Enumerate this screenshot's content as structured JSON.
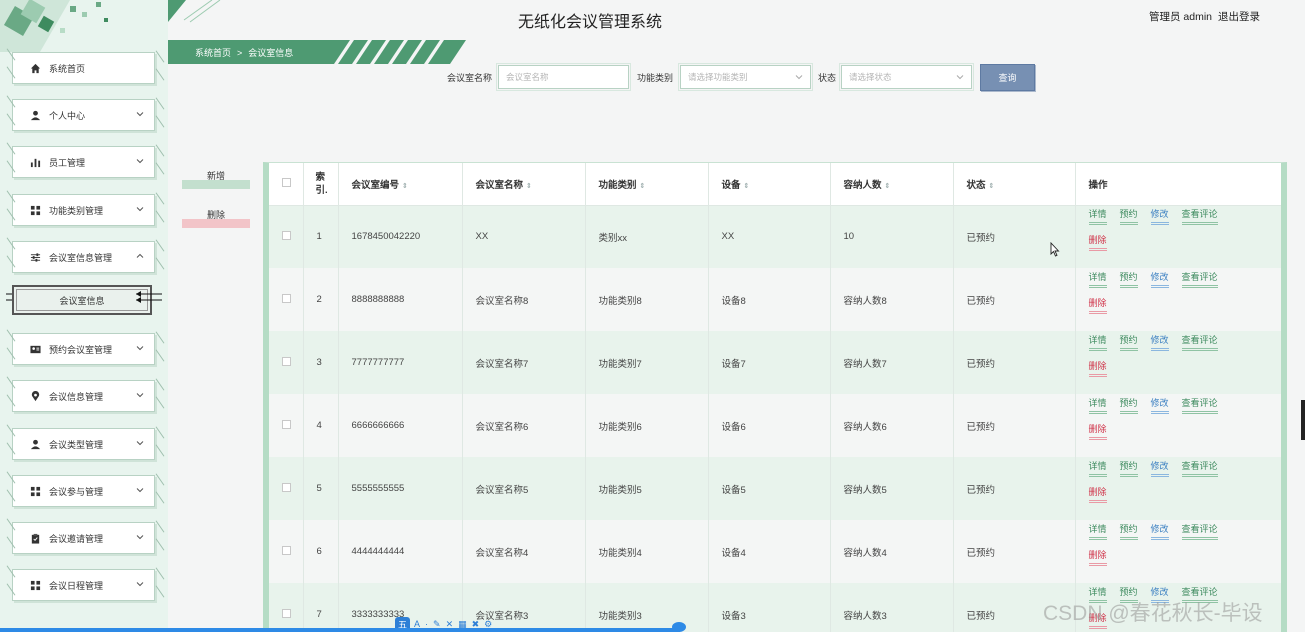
{
  "header": {
    "title": "无纸化会议管理系统",
    "user": "管理员 admin",
    "logout": "退出登录"
  },
  "breadcrumb": {
    "home": "系统首页",
    "sep": ">",
    "current": "会议室信息"
  },
  "sidebar": {
    "items": [
      {
        "label": "系统首页",
        "icon": "home-icon",
        "has_arrow": false
      },
      {
        "label": "个人中心",
        "icon": "user-icon",
        "has_arrow": true
      },
      {
        "label": "员工管理",
        "icon": "bar-chart-icon",
        "has_arrow": true
      },
      {
        "label": "功能类别管理",
        "icon": "grid-icon",
        "has_arrow": true
      },
      {
        "label": "会议室信息管理",
        "icon": "sliders-icon",
        "has_arrow": true,
        "expanded": true
      },
      {
        "label": "预约会议室管理",
        "icon": "id-card-icon",
        "has_arrow": true
      },
      {
        "label": "会议信息管理",
        "icon": "location-pin-icon",
        "has_arrow": true
      },
      {
        "label": "会议类型管理",
        "icon": "user-icon",
        "has_arrow": true
      },
      {
        "label": "会议参与管理",
        "icon": "grid-icon",
        "has_arrow": true
      },
      {
        "label": "会议邀请管理",
        "icon": "clipboard-icon",
        "has_arrow": true
      },
      {
        "label": "会议日程管理",
        "icon": "grid-icon",
        "has_arrow": true
      }
    ],
    "submenu": {
      "label": "会议室信息"
    }
  },
  "search": {
    "name_label": "会议室名称",
    "name_placeholder": "会议室名称",
    "type_label": "功能类别",
    "type_placeholder": "请选择功能类别",
    "status_label": "状态",
    "status_placeholder": "请选择状态",
    "button": "查询"
  },
  "actions": {
    "add": "新增",
    "delete": "删除"
  },
  "table": {
    "columns": [
      "索引",
      "会议室编号",
      "会议室名称",
      "功能类别",
      "设备",
      "容纳人数",
      "状态",
      "操作"
    ],
    "index_header_top": "索",
    "index_header_bottom": "引.",
    "rows": [
      {
        "index": "1",
        "code": "1678450042220",
        "name": "XX",
        "type": "类别xx",
        "equipment": "XX",
        "capacity": "10",
        "status": "已预约"
      },
      {
        "index": "2",
        "code": "8888888888",
        "name": "会议室名称8",
        "type": "功能类别8",
        "equipment": "设备8",
        "capacity": "容纳人数8",
        "status": "已预约"
      },
      {
        "index": "3",
        "code": "7777777777",
        "name": "会议室名称7",
        "type": "功能类别7",
        "equipment": "设备7",
        "capacity": "容纳人数7",
        "status": "已预约"
      },
      {
        "index": "4",
        "code": "6666666666",
        "name": "会议室名称6",
        "type": "功能类别6",
        "equipment": "设备6",
        "capacity": "容纳人数6",
        "status": "已预约"
      },
      {
        "index": "5",
        "code": "5555555555",
        "name": "会议室名称5",
        "type": "功能类别5",
        "equipment": "设备5",
        "capacity": "容纳人数5",
        "status": "已预约"
      },
      {
        "index": "6",
        "code": "4444444444",
        "name": "会议室名称4",
        "type": "功能类别4",
        "equipment": "设备4",
        "capacity": "容纳人数4",
        "status": "已预约"
      },
      {
        "index": "7",
        "code": "3333333333",
        "name": "会议室名称3",
        "type": "功能类别3",
        "equipment": "设备3",
        "capacity": "容纳人数3",
        "status": "已预约"
      }
    ],
    "ops": {
      "detail": "详情",
      "reserve": "预约",
      "edit": "修改",
      "review": "查看评论",
      "delete": "删除"
    }
  },
  "overlay": {
    "ime_logo": "五",
    "ime_items": [
      "A",
      "·",
      "✎",
      "✕",
      "▦",
      "✖",
      "⚙"
    ],
    "watermark": "CSDN @春花秋长-毕设"
  },
  "colors": {
    "accent": "#4e9a72",
    "sidebar_bg": "#e8f4ee",
    "row_odd": "#e8f3ec",
    "search_button": "#7790b3",
    "op_green": "#3e8b5f",
    "op_blue": "#3a7fc1",
    "op_red": "#d0344a"
  }
}
